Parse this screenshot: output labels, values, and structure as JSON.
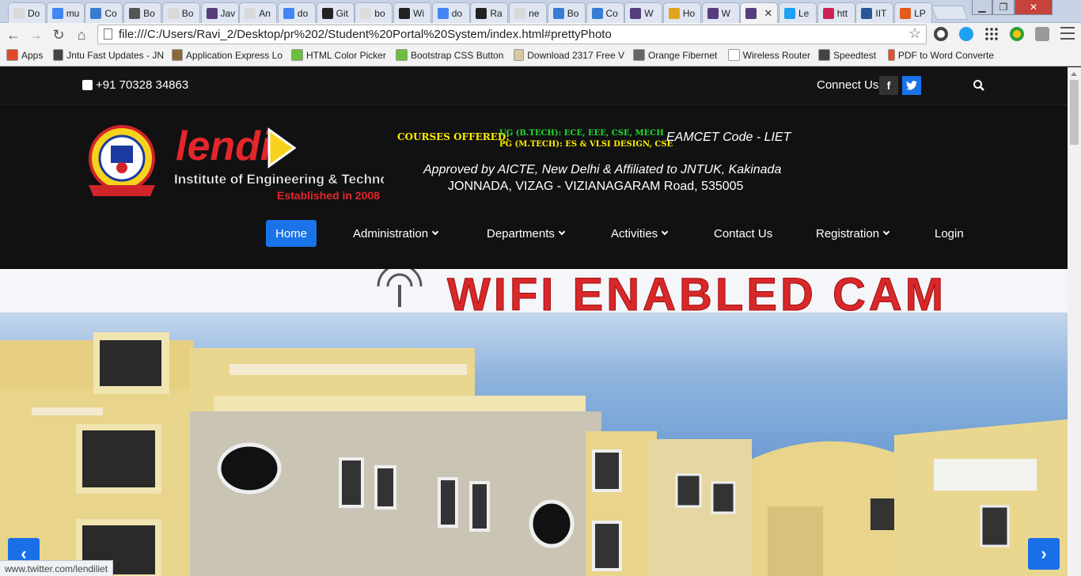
{
  "browser": {
    "tabs": [
      {
        "label": "Do",
        "color": "#d9d9d9"
      },
      {
        "label": "mu",
        "color": "#4285f4"
      },
      {
        "label": "Co",
        "color": "#3a7bd5"
      },
      {
        "label": "Bo",
        "color": "#555555"
      },
      {
        "label": "Bo",
        "color": "#d9d9d9"
      },
      {
        "label": "Jav",
        "color": "#563d7c"
      },
      {
        "label": "An",
        "color": "#d9d9d9"
      },
      {
        "label": "do",
        "color": "#4285f4"
      },
      {
        "label": "Git",
        "color": "#222222"
      },
      {
        "label": "bo",
        "color": "#dddddd"
      },
      {
        "label": "Wi",
        "color": "#222222"
      },
      {
        "label": "do",
        "color": "#4285f4"
      },
      {
        "label": "Ra",
        "color": "#222222"
      },
      {
        "label": "ne",
        "color": "#d9d9d9"
      },
      {
        "label": "Bo",
        "color": "#3a7bd5"
      },
      {
        "label": "Co",
        "color": "#3a7bd5"
      },
      {
        "label": "W",
        "color": "#563d7c"
      },
      {
        "label": "Ho",
        "color": "#e2a41c"
      },
      {
        "label": "W",
        "color": "#563d7c"
      },
      {
        "label": "",
        "color": "#563d7c",
        "active": true
      },
      {
        "label": "Le",
        "color": "#1da1f2"
      },
      {
        "label": "htt",
        "color": "#cc2255"
      },
      {
        "label": "IIT",
        "color": "#2a5599"
      },
      {
        "label": "LP",
        "color": "#e25a1c"
      }
    ],
    "url": "file:///C:/Users/Ravi_2/Desktop/pr%202/Student%20Portal%20System/index.html#prettyPhoto",
    "bookmarks": [
      {
        "label": "Apps",
        "color": "#e04a2a"
      },
      {
        "label": "Jntu Fast Updates - JN",
        "color": "#444444"
      },
      {
        "label": "Application Express Lo",
        "color": "#8a6a3a"
      },
      {
        "label": "HTML Color Picker",
        "color": "#6cbf3b"
      },
      {
        "label": "Bootstrap CSS Button",
        "color": "#6cbf3b"
      },
      {
        "label": "Download 2317 Free V",
        "color": "#d8c8a0"
      },
      {
        "label": "Orange Fibernet",
        "color": "#666666"
      },
      {
        "label": "Wireless Router",
        "color": "#ffffff"
      },
      {
        "label": "Speedtest",
        "color": "#444444"
      },
      {
        "label": "PDF to Word Converte",
        "color": "#e6502a"
      }
    ],
    "status_url": "www.twitter.com/lendiliet"
  },
  "site": {
    "phone": "+91 70328 34863",
    "connect_label": "Connect Us",
    "facebook_label": "f",
    "twitter_label": "t",
    "logo": {
      "brand": "lendi",
      "tagline": "Institute of Engineering & Technology",
      "established": "Established in 2008"
    },
    "courses": {
      "label": "COURSES OFFERED:",
      "ug": "UG (B.TECH): ECE, EEE, CSE, MECH",
      "pg": "PG (M.TECH): ES & VLSI DESIGN, CSE"
    },
    "eamcet": "EAMCET Code - LIET",
    "approved": "Approved by AICTE, New Delhi & Affiliated to JNTUK, Kakinada",
    "address": "JONNADA, VIZAG - VIZIANAGARAM Road, 535005",
    "nav": [
      {
        "label": "Home",
        "active": true,
        "dropdown": false
      },
      {
        "label": "Administration",
        "dropdown": true
      },
      {
        "label": "Departments",
        "dropdown": true
      },
      {
        "label": "Activities",
        "dropdown": true
      },
      {
        "label": "Contact Us",
        "dropdown": false
      },
      {
        "label": "Registration",
        "dropdown": true
      },
      {
        "label": "Login",
        "dropdown": false
      }
    ],
    "hero_banner": "WIFI ENABLED CAM",
    "accent": "#1a73e8"
  }
}
